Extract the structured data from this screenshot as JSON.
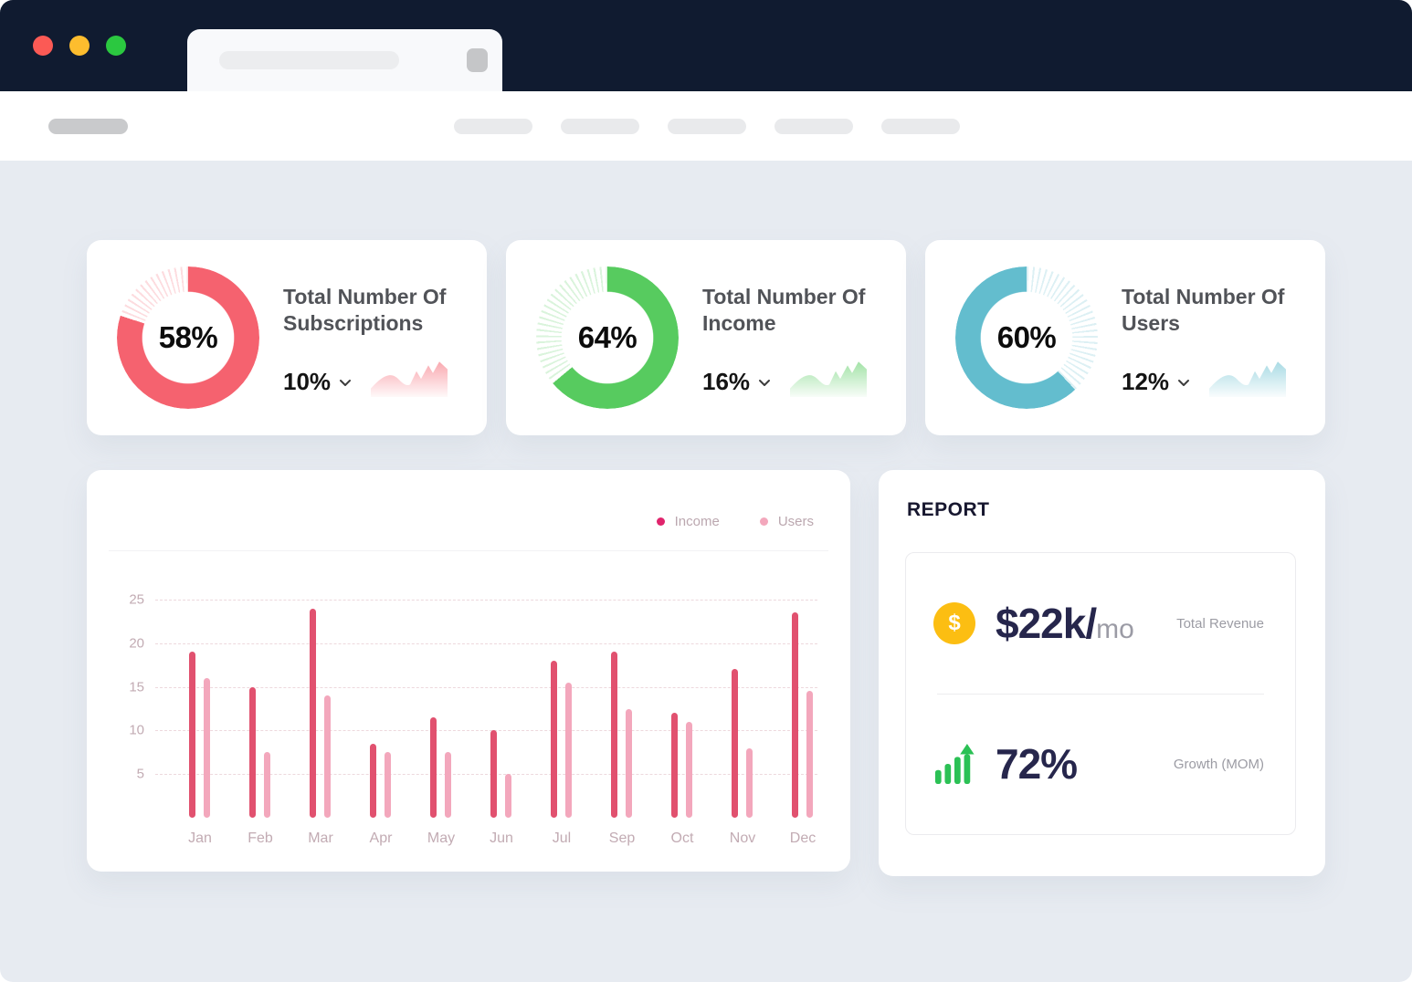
{
  "colors": {
    "topbar": "#101B30",
    "traffic_red": "#FB5A55",
    "traffic_yellow": "#FDBD2E",
    "traffic_green": "#2BC840",
    "content_bg": "#E7EBF1",
    "accent_subscriptions": "#F5626F",
    "accent_income": "#57CB5F",
    "accent_users": "#63BDCE",
    "bar_income": "#E1516F",
    "bar_users": "#F3A7BC",
    "navy_text": "#26264C",
    "coin_yellow": "#FCBE12",
    "growth_green": "#2BC155"
  },
  "chart_data": [
    {
      "type": "donut",
      "title": "Total Number Of Subscriptions",
      "center_label": "58%",
      "percent": 58,
      "delta_label": "10%",
      "color": "#F5626F",
      "arc_start_deg": 0,
      "arc_sweep_deg": 288,
      "remainder_style": "hatched-ticks"
    },
    {
      "type": "donut",
      "title": "Total Number Of Income",
      "center_label": "64%",
      "percent": 64,
      "delta_label": "16%",
      "color": "#57CB5F",
      "arc_start_deg": 0,
      "arc_sweep_deg": 230,
      "remainder_style": "hatched-ticks"
    },
    {
      "type": "donut",
      "title": "Total Number Of Users",
      "center_label": "60%",
      "percent": 60,
      "delta_label": "12%",
      "color": "#63BDCE",
      "arc_start_deg": 137,
      "arc_sweep_deg": 223,
      "remainder_style": "hatched-ticks"
    },
    {
      "type": "bar",
      "categories": [
        "Jan",
        "Feb",
        "Mar",
        "Apr",
        "May",
        "Jun",
        "Jul",
        "Sep",
        "Oct",
        "Nov",
        "Dec"
      ],
      "series": [
        {
          "name": "Income",
          "color": "#E1516F",
          "values": [
            19,
            15,
            24,
            8.5,
            11.5,
            10,
            18,
            19,
            12,
            17,
            23.5
          ]
        },
        {
          "name": "Users",
          "color": "#F3A7BC",
          "values": [
            16,
            7.5,
            14,
            7.5,
            7.5,
            5,
            15.5,
            12.5,
            11,
            8,
            14.5
          ]
        }
      ],
      "ylim": [
        0,
        25
      ],
      "yticks": [
        25,
        20,
        15,
        10,
        5
      ],
      "grid": "dashed-horizontal",
      "legend_position": "top-right"
    }
  ],
  "report": {
    "heading": "REPORT",
    "rows": [
      {
        "icon": "dollar-coin",
        "value": "$22k/",
        "suffix": "mo",
        "label": "Total Revenue"
      },
      {
        "icon": "growth-bars",
        "value": "72%",
        "suffix": "",
        "label": "Growth (MOM)"
      }
    ]
  }
}
